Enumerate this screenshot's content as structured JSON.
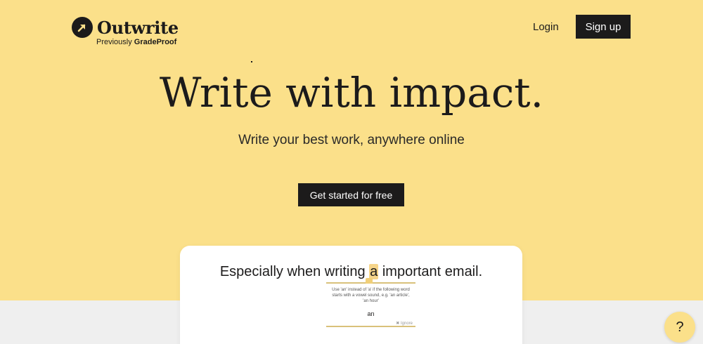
{
  "brand": {
    "name": "Outwrite",
    "previously_prefix": "Previously ",
    "previously_name": "GradeProof",
    "icon": "arrow-up-right-icon"
  },
  "nav": {
    "login_label": "Login",
    "signup_label": "Sign up"
  },
  "hero": {
    "title": "Write with impact.",
    "subtitle": "Write your best work, anywhere online",
    "cta_label": "Get started for free"
  },
  "demo": {
    "sentence_before": "Especially when writing ",
    "flagged_word": "a",
    "sentence_after": " important email.",
    "suggestion_text": "Use 'an' instead of 'a' if the following word starts with a vowel sound, e.g. 'an article', 'an hour'",
    "suggestion_fix": "an",
    "ignore_label": "✖ Ignore"
  },
  "help": {
    "label": "?"
  },
  "colors": {
    "background": "#fbe08a",
    "dark": "#1c1b1b",
    "band": "#efefef"
  }
}
